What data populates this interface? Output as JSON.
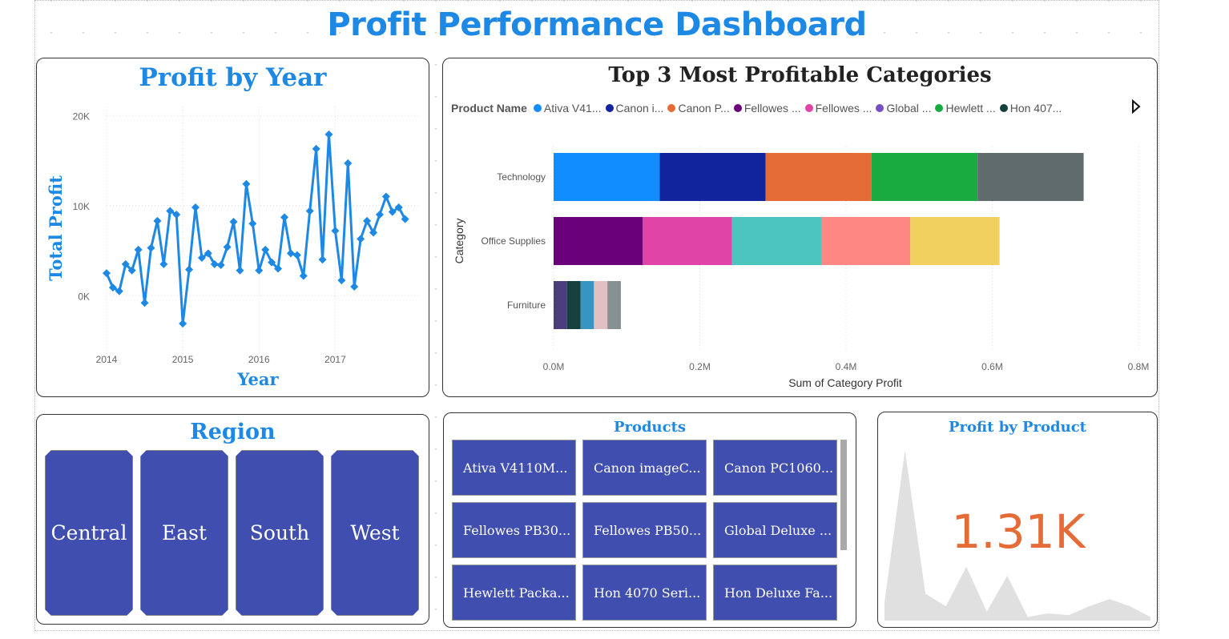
{
  "dashboard": {
    "title": "Profit Performance Dashboard"
  },
  "profit_by_year": {
    "title": "Profit by Year",
    "ylabel": "Total Profit",
    "xlabel": "Year",
    "color": "#1e88e5"
  },
  "top_categories": {
    "title": "Top 3 Most Profitable Categories",
    "legend_title": "Product Name",
    "legend_items": [
      {
        "label": "Ativa V41...",
        "color": "#118dff"
      },
      {
        "label": "Canon i...",
        "color": "#12239e"
      },
      {
        "label": "Canon P...",
        "color": "#e66c37"
      },
      {
        "label": "Fellowes ...",
        "color": "#6b007b"
      },
      {
        "label": "Fellowes ...",
        "color": "#e044a7"
      },
      {
        "label": "Global ...",
        "color": "#744ec2"
      },
      {
        "label": "Hewlett ...",
        "color": "#1aab40"
      },
      {
        "label": "Hon 407...",
        "color": "#15403e"
      }
    ],
    "ylabel": "Category",
    "xlabel": "Sum of Category Profit"
  },
  "region": {
    "title": "Region",
    "items": [
      "Central",
      "East",
      "South",
      "West"
    ],
    "tile_color": "#3f4eaf"
  },
  "products": {
    "title": "Products",
    "items": [
      "Ativa V4110M...",
      "Canon imageC...",
      "Canon PC1060...",
      "Fellowes PB30...",
      "Fellowes PB50...",
      "Global Deluxe ...",
      "Hewlett Packa...",
      "Hon 4070 Seri...",
      "Hon Deluxe Fa..."
    ]
  },
  "profit_by_product": {
    "title": "Profit by Product",
    "value": "1.31K",
    "value_color": "#e66c37",
    "sparkline": [
      0.1,
      0.95,
      0.15,
      0.08,
      0.3,
      0.05,
      0.25,
      0.02,
      0.04,
      0.03,
      0.08,
      0.12,
      0.08,
      0.02
    ],
    "sparkline_color": "#e0e0e0"
  },
  "chart_data": [
    {
      "type": "line",
      "title": "Profit by Year",
      "xlabel": "Year",
      "ylabel": "Total Profit",
      "x_ticks": [
        "2014",
        "2015",
        "2016",
        "2017"
      ],
      "y_ticks": [
        "0K",
        "10K",
        "20K"
      ],
      "xlim": [
        "2014-01",
        "2017-12"
      ],
      "ylim": [
        -7000,
        21000
      ],
      "grid": true,
      "x": [
        "2014-01",
        "2014-02",
        "2014-03",
        "2014-04",
        "2014-05",
        "2014-06",
        "2014-07",
        "2014-08",
        "2014-09",
        "2014-10",
        "2014-11",
        "2014-12",
        "2015-01",
        "2015-02",
        "2015-03",
        "2015-04",
        "2015-05",
        "2015-06",
        "2015-07",
        "2015-08",
        "2015-09",
        "2015-10",
        "2015-11",
        "2015-12",
        "2016-01",
        "2016-02",
        "2016-03",
        "2016-04",
        "2016-05",
        "2016-06",
        "2016-07",
        "2016-08",
        "2016-09",
        "2016-10",
        "2016-11",
        "2016-12",
        "2017-01",
        "2017-02",
        "2017-03",
        "2017-04",
        "2017-05",
        "2017-06",
        "2017-07",
        "2017-08",
        "2017-09",
        "2017-10",
        "2017-11",
        "2017-12"
      ],
      "values": [
        2500,
        900,
        500,
        3500,
        2800,
        5100,
        -800,
        5300,
        8300,
        3500,
        9400,
        9000,
        -3100,
        2900,
        9800,
        4200,
        4700,
        3500,
        3400,
        5400,
        8200,
        2800,
        12400,
        8000,
        2800,
        5100,
        3700,
        3000,
        8700,
        4700,
        4500,
        2200,
        9400,
        16300,
        4000,
        17900,
        7200,
        1700,
        14700,
        1000,
        6300,
        8300,
        7000,
        9000,
        11000,
        9300,
        9800,
        8500
      ]
    },
    {
      "type": "bar",
      "orientation": "horizontal",
      "stacked": true,
      "title": "Top 3 Most Profitable Categories",
      "xlabel": "Sum of Category Profit",
      "ylabel": "Category",
      "categories": [
        "Technology",
        "Office Supplies",
        "Furniture"
      ],
      "x_ticks": [
        "0.0M",
        "0.2M",
        "0.4M",
        "0.6M",
        "0.8M"
      ],
      "xlim": [
        0,
        0.8
      ],
      "grid": true,
      "segments": [
        {
          "category": "Technology",
          "values": [
            0.145,
            0.145,
            0.145,
            0.145,
            0.145
          ],
          "colors": [
            "#118dff",
            "#12239e",
            "#e66c37",
            "#1aab40",
            "#5f6b6d"
          ]
        },
        {
          "category": "Office Supplies",
          "values": [
            0.122,
            0.122,
            0.122,
            0.122,
            0.122
          ],
          "colors": [
            "#6b007b",
            "#e044a7",
            "#4bc5be",
            "#fe8683",
            "#f2d05d"
          ]
        },
        {
          "category": "Furniture",
          "values": [
            0.0184,
            0.0184,
            0.0184,
            0.0184,
            0.0184
          ],
          "colors": [
            "#4c3d7c",
            "#15403e",
            "#3a94c1",
            "#e2bfc3",
            "#868f91"
          ]
        }
      ]
    }
  ]
}
